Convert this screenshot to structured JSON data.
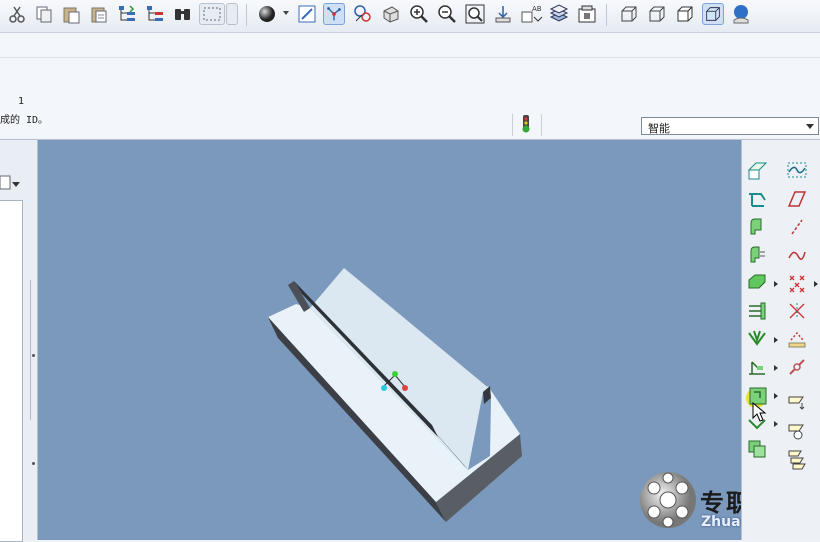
{
  "toolbar": {
    "icons": [
      "cut-icon",
      "copy-icon",
      "paste-icon",
      "paste-special-icon",
      "regenerate-icon",
      "regenerate-manager-icon",
      "find-icon",
      "select-box-icon",
      "appearance-sphere-icon",
      "repaint-icon",
      "spin-center-icon",
      "datum-display-icon",
      "orient-icon",
      "zoom-in-icon",
      "zoom-out-icon",
      "refit-icon",
      "reorient-icon",
      "annotation-display-icon",
      "layers-icon",
      "view-manager-icon",
      "wireframe-icon",
      "hidden-line-icon",
      "no-hidden-icon",
      "shading-icon",
      "help-icon"
    ]
  },
  "message_area": {
    "line_number": "1",
    "message": "成的 ID。"
  },
  "filter": {
    "selected": "智能"
  },
  "right_toolbar": {
    "icons": [
      "datum-plane-icon",
      "sketch-icon",
      "datum-axis-icon",
      "datum-curve-icon",
      "extrude-icon",
      "style-icon",
      "revolve-icon",
      "point-icon",
      "sweep-icon",
      "csys-icon",
      "blend-icon",
      "analysis-icon",
      "hole-icon",
      "flat-icon",
      "rib-icon",
      "chain-icon",
      "round-icon",
      "chamfer-icon",
      "draft-icon",
      "shell-icon",
      "copy-feature-icon",
      "pattern-icon"
    ]
  },
  "watermark": {
    "text": "专职网",
    "url": "Zhuanzhi.Net"
  }
}
